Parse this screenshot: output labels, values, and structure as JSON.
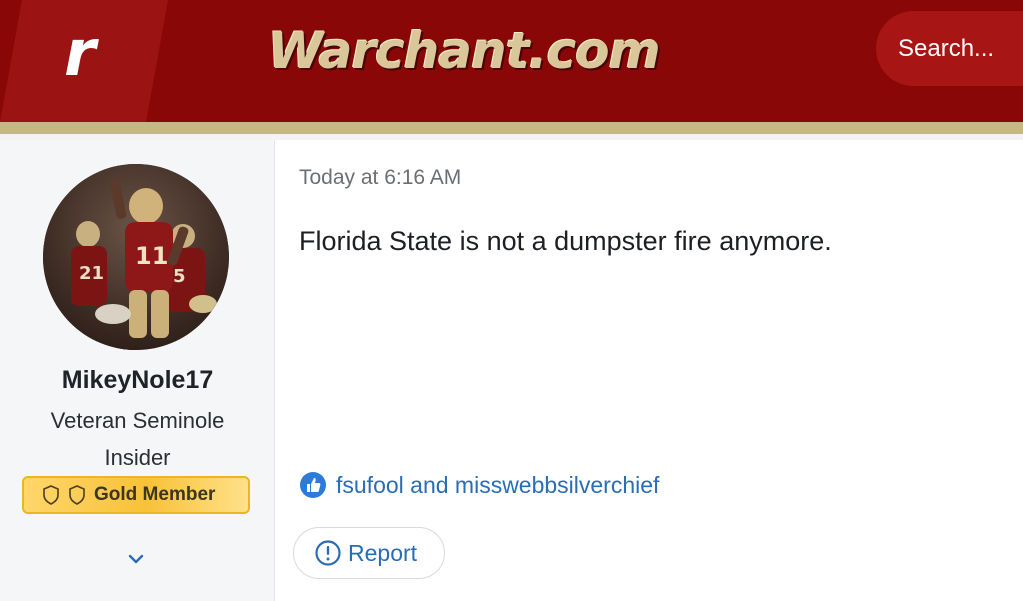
{
  "header": {
    "brand_letter": "r",
    "site_title": "Warchant.com",
    "search_label": "Search..."
  },
  "user": {
    "username": "MikeyNole17",
    "title": "Veteran Seminole Insider",
    "badge_label": "Gold Member"
  },
  "post": {
    "timestamp": "Today at 6:16 AM",
    "body": "Florida State is not a dumpster fire anymore.",
    "reactions": "fsufool and misswebbsilverchief",
    "report_label": "Report"
  },
  "icons": {
    "brand": "brand-logo-icon",
    "shield": "shield-icon",
    "chevron": "chevron-down-icon",
    "like": "thumbs-up-icon",
    "report": "exclamation-circle-icon"
  },
  "colors": {
    "header_bg": "#8a0707",
    "header_stripe": "#c7b784",
    "link": "#2a6db5",
    "badge_gold": "#f7c238"
  }
}
